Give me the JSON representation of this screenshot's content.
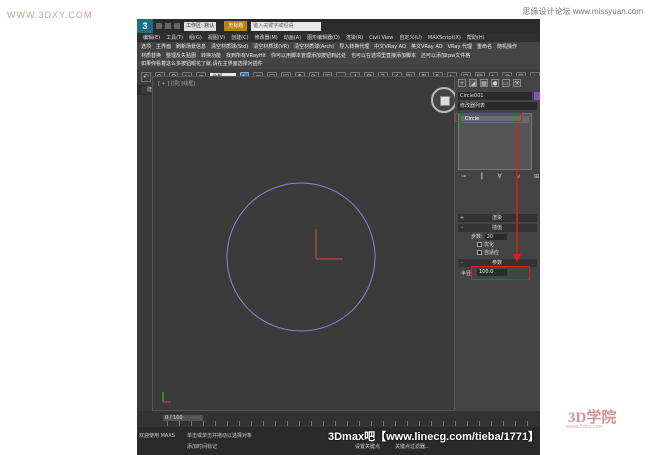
{
  "watermarks": {
    "top_left": "WWW.3DXY.COM",
    "top_right": "思缘设计论坛 www.missyuan.com",
    "bottom": "3Dmax吧【www.linecg.com/tieba/1771】",
    "corner_logo": "3D学院",
    "corner_sub": "www.3dxy.com"
  },
  "titlebar": {
    "logo": "3",
    "workspace": "工作区: 默认",
    "tab": "无标题",
    "search_placeholder": "键入关键字或短语"
  },
  "menu": [
    "编辑(E)",
    "工具(T)",
    "组(G)",
    "视图(V)",
    "创建(C)",
    "修改器(M)",
    "动画(A)",
    "图形编辑器(D)",
    "渲染(R)",
    "Civil View",
    "自定义(U)",
    "MAXScript(X)",
    "帮助(H)"
  ],
  "ribbon_rows": [
    [
      "选项",
      "主界面",
      "刷新场景信息",
      "清空材质球(Std)",
      "清空材质球(VR)",
      "清空材质球(Arch)",
      "导入转换代理",
      "中文VRay AO",
      "英文VRay AO",
      "VRay 代理",
      "重命名",
      "随机操作"
    ],
    [
      "材质替换",
      "整理反失贴图",
      "转换功能",
      "找到所有VRayHit",
      "你可以用脚本管理添加按钮到此处",
      "也可以在选项里直接添加脚本",
      "还可以添加tpw文件格"
    ],
    [
      "如果你看着这么多按钮眼花了就,请在主界面选择对插件"
    ]
  ],
  "toolbar": {
    "select_filter": "全部"
  },
  "viewport_tabs": [
    {
      "label": "建模",
      "active": false
    },
    {
      "label": "自由形式",
      "active": true
    },
    {
      "label": "选择",
      "active": false
    },
    {
      "label": "对象绘制",
      "active": false
    },
    {
      "label": "填充",
      "active": false
    }
  ],
  "viewport": {
    "label": "[ + ] [顶] [线框]",
    "navcube_label": "顶",
    "circle_color": "#9a7fd6"
  },
  "command_panel": {
    "object_name": "Circle001",
    "object_color": "#8a4fd1",
    "modifier_list": "修改器列表",
    "stack_item": "Circle",
    "rollouts": {
      "render": "渲染",
      "interpolation": "插值",
      "parameters": "参数"
    },
    "steps_label": "步数:",
    "steps_value": "20",
    "optimize_label": "优化",
    "adaptive_label": "自适应",
    "radius_label": "半径:",
    "radius_value": "100.0"
  },
  "timeline": {
    "position": "0 / 100"
  },
  "status": {
    "welcome": "欢迎使用 MAXS",
    "hint": "单击或单击并拖动以选择对象",
    "add_time_tag": "添加时间标记",
    "set_key": "设置关键点",
    "key_filters": "关键点过滤器..."
  }
}
